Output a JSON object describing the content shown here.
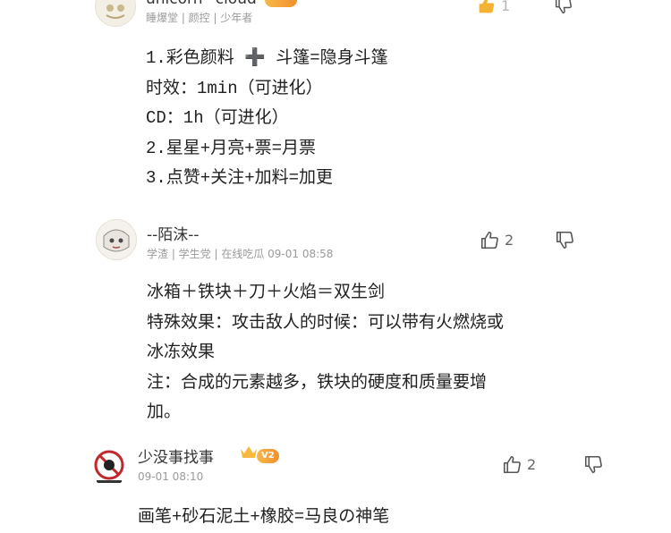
{
  "comments": [
    {
      "name": "unicorn~cloud",
      "meta": "睡爆堂 | 颜控 | 少年者",
      "likes": "1",
      "body": "1.彩色颜料 ➕ 斗篷=隐身斗篷\n时效：1min（可进化）\nCD：1h（可进化）\n2.星星+月亮+票=月票\n3.点赞+关注+加料=加更"
    },
    {
      "name": "--陌沫--",
      "meta": "学渣 | 学生党 | 在线吃瓜   09-01 08:58",
      "likes": "2",
      "body": "冰箱＋铁块＋刀＋火焰＝双生剑\n特殊效果：攻击敌人的时候：可以带有火燃烧或\n冰冻效果\n注：合成的元素越多，铁块的硬度和质量要增\n加。"
    },
    {
      "name": "少没事找事",
      "badge": "V2",
      "meta": "09-01 08:10",
      "likes": "2",
      "body": "画笔+砂石泥土+橡胶=马良の神笔"
    }
  ],
  "colors": {
    "badge": "#f39a2e",
    "meta": "#9a9a9a",
    "text": "#222222"
  },
  "icons": [
    "thumbs-up-icon",
    "thumbs-down-icon",
    "crown-icon"
  ]
}
